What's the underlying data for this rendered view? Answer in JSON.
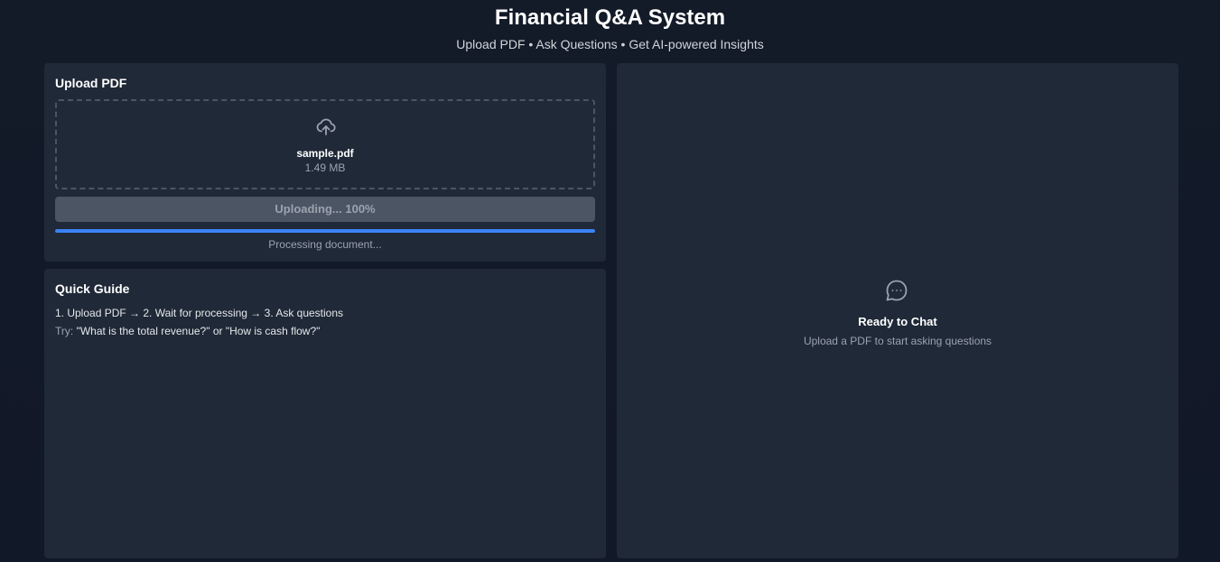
{
  "header": {
    "title": "Financial Q&A System",
    "subtitle": "Upload PDF • Ask Questions • Get AI-powered Insights"
  },
  "upload": {
    "title": "Upload PDF",
    "icon": "upload-cloud-icon",
    "file_name": "sample.pdf",
    "file_size": "1.49 MB",
    "button_label": "Uploading... 100%",
    "progress": 1.0,
    "status": "Processing document...",
    "accent_color": "#3b82f6"
  },
  "guide": {
    "title": "Quick Guide",
    "steps": "1. Upload PDF → 2. Wait for processing → 3. Ask questions",
    "try_label": "Try:",
    "try_examples": "\"What is the total revenue?\" or \"How is cash flow?\""
  },
  "chat": {
    "icon": "chat-bubble-icon",
    "title": "Ready to Chat",
    "subtitle": "Upload a PDF to start asking questions"
  }
}
